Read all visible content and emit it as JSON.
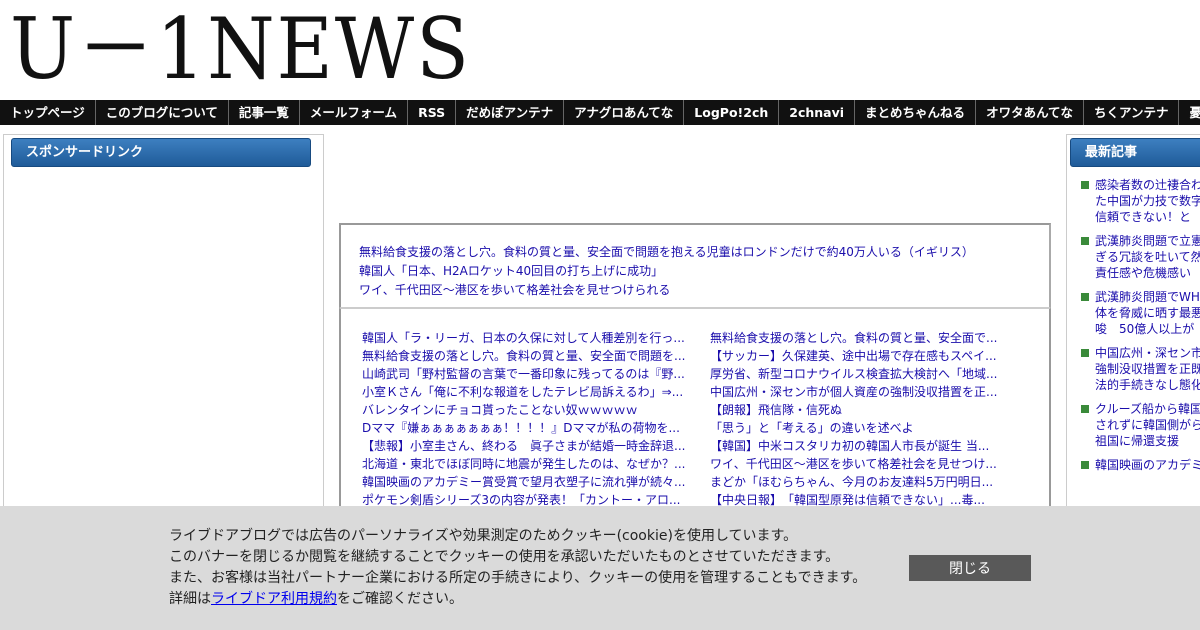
{
  "logo": {
    "text": "U－1NEWS"
  },
  "nav": {
    "items": [
      "トップページ",
      "このブログについて",
      "記事一覧",
      "メールフォーム",
      "RSS",
      "だめぽアンテナ",
      "アナグロあんてな",
      "LogPo!2ch",
      "2chnavi",
      "まとめちゃんねる",
      "オワタあんてな",
      "ちくアンテナ",
      "憂国あんてな"
    ]
  },
  "sidebar_left": {
    "header": "スポンサードリンク"
  },
  "sidebar_right": {
    "header": "最新記事",
    "items": [
      "感染者数の辻褄合わせた中国が力技で数字然信頼できない！と",
      "武漢肺炎問題で立憲すぎる冗談を吐いて然　責任感や危機感い",
      "武漢肺炎問題でWHO体を脅威に晒す最悪示唆　50億人以上が",
      "中国広州・深セン市の強制没収措置を正既に法的手続きなし態化",
      "クルーズ船から韓国許されずに韓国側がら　祖国に帰還支援",
      "韓国映画のアカデミー"
    ]
  },
  "top_links": [
    "無料給食支援の落とし穴。食料の質と量、安全面で問題を抱える児童はロンドンだけで約40万人いる（イギリス）",
    "韓国人「日本、H2Aロケット40回目の打ち上げに成功」",
    "ワイ、千代田区～港区を歩いて格差社会を見せつけられる"
  ],
  "grid_links": {
    "col1": [
      "韓国人「ラ・リーガ、日本の久保に対して人種差別を行っ...",
      "無料給食支援の落とし穴。食料の質と量、安全面で問題を...",
      "山崎武司「野村監督の言葉で一番印象に残ってるのは『野...",
      "小室Ｋさん「俺に不利な報道をしたテレビ局訴えるわ」⇒...",
      "バレンタインにチョコ貰ったことない奴ｗｗｗｗｗ",
      "Dママ『嫌ぁぁぁぁぁぁぁ！！！！』Dママが私の荷物を...",
      "【悲報】小室圭さん、終わる　眞子さまが結婚一時金辞退...",
      "北海道・東北でほぼ同時に地震が発生したのは、なぜか？...",
      "韓国映画のアカデミー賞受賞で望月衣塑子に流れ弾が続々...",
      "ポケモン剣盾シリーズ3の内容が発表！「カントー・アロ..."
    ],
    "col2": [
      "無料給食支援の落とし穴。食料の質と量、安全面で...",
      "【サッカー】久保建英、途中出場で存在感もスペイ...",
      "厚労省、新型コロナウイルス検査拡大検討へ「地域...",
      "中国広州・深セン市が個人資産の強制没収措置を正...",
      "【朗報】飛信隊・信死ぬ",
      "「思う」と「考える」の違いを述べよ",
      "【韓国】中米コスタリカ初の韓国人市長が誕生 当...",
      "ワイ、千代田区～港区を歩いて格差社会を見せつけ...",
      "まどか「ほむらちゃん、今月のお友達料5万円明日...",
      "【中央日報】　「韓国型原発は信頼できない」...毒..."
    ]
  },
  "cookie": {
    "line1": "ライブドアブログでは広告のパーソナライズや効果測定のためクッキー(cookie)を使用しています。",
    "line2": "このバナーを閉じるか閲覧を継続することでクッキーの使用を承認いただいたものとさせていただきます。",
    "line3": "また、お客様は当社パートナー企業における所定の手続きにより、クッキーの使用を管理することもできます。",
    "line4_prefix": "詳細は",
    "line4_link": "ライブドア利用規約",
    "line4_suffix": "をご確認ください。",
    "close_label": "閉じる"
  }
}
